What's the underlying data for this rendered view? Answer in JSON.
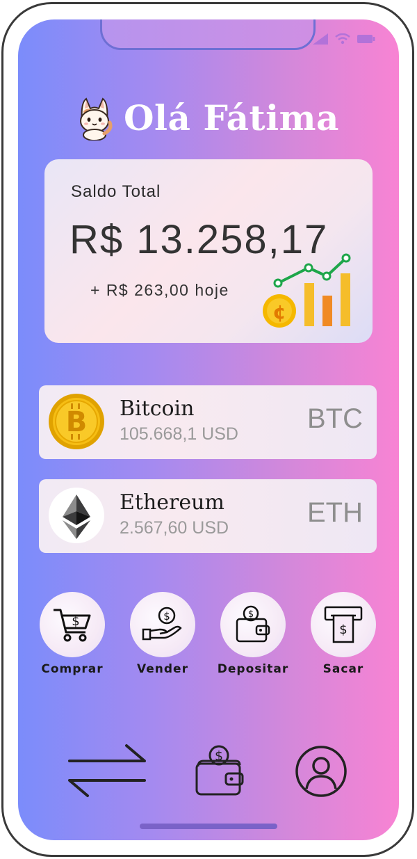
{
  "greeting": {
    "title": "Olá Fátima",
    "avatar_icon": "cat-icon"
  },
  "balance": {
    "label": "Saldo Total",
    "value": "R$ 13.258,17",
    "change": "+ R$ 263,00 hoje",
    "illustration_icon": "growth-chart-icon"
  },
  "coins": [
    {
      "name": "Bitcoin",
      "price": "105.668,1 USD",
      "symbol": "BTC",
      "icon": "bitcoin-icon",
      "color": "#f5b800"
    },
    {
      "name": "Ethereum",
      "price": "2.567,60 USD",
      "symbol": "ETH",
      "icon": "ethereum-icon",
      "color": "#3c3c3d"
    }
  ],
  "actions": [
    {
      "label": "Comprar",
      "icon": "cart-dollar-icon"
    },
    {
      "label": "Vender",
      "icon": "hand-coin-icon"
    },
    {
      "label": "Depositar",
      "icon": "wallet-coin-icon"
    },
    {
      "label": "Sacar",
      "icon": "atm-withdraw-icon"
    }
  ],
  "bottom_nav": [
    {
      "icon": "transfer-arrows-icon"
    },
    {
      "icon": "wallet-icon"
    },
    {
      "icon": "profile-icon"
    }
  ],
  "colors": {
    "gradient_start": "#7b8cfb",
    "gradient_end": "#f883d3",
    "text_dark": "#333333",
    "coin_price_gray": "#9a9a9a"
  }
}
